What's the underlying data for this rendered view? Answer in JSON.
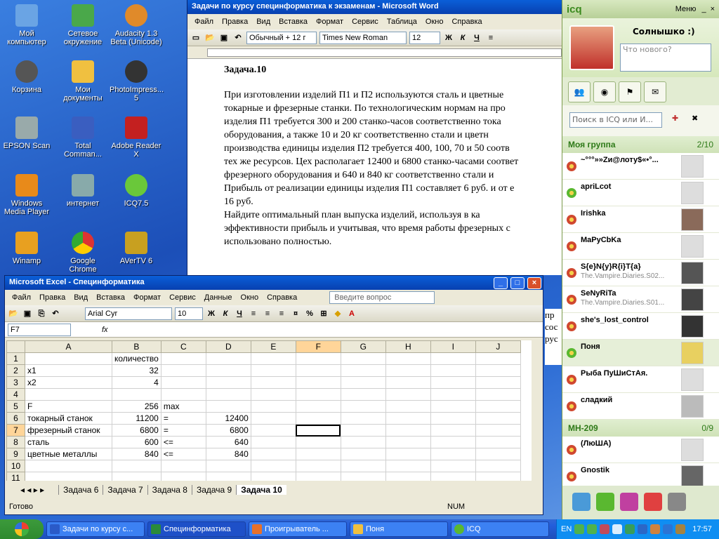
{
  "desktop_icons": [
    {
      "label": "Мой компьютер"
    },
    {
      "label": "Сетевое окружение"
    },
    {
      "label": "Audacity 1.3 Beta (Unicode)"
    },
    {
      "label": "Корзина"
    },
    {
      "label": "Мои документы"
    },
    {
      "label": "PhotoImpress... 5"
    },
    {
      "label": "EPSON Scan"
    },
    {
      "label": "Total Comman..."
    },
    {
      "label": "Adobe Reader X"
    },
    {
      "label": "Windows Media Player"
    },
    {
      "label": "интернет"
    },
    {
      "label": "ICQ7.5"
    },
    {
      "label": "Winamp"
    },
    {
      "label": "Google Chrome"
    },
    {
      "label": "AVerTV 6"
    }
  ],
  "word": {
    "title": "Задачи по курсу специнформатика к экзаменам - Microsoft Word",
    "menu": [
      "Файл",
      "Правка",
      "Вид",
      "Вставка",
      "Формат",
      "Сервис",
      "Таблица",
      "Окно",
      "Справка"
    ],
    "style_box": "Обычный + 12 г",
    "font_box": "Times New Roman",
    "size_box": "12",
    "bold": "Ж",
    "italic": "К",
    "underline": "Ч",
    "heading": "Задача.10",
    "lines": [
      "При изготовлении изделий П1 и П2  используются сталь и цветные",
      "токарные и фрезерные станки. По технологическим нормам на про",
      "изделия П1 требуется 300 и 200 станко-часов соответственно тока",
      "оборудования, а также 10 и 20 кг соответственно стали и цветн",
      "производства единицы изделия П2  требуется 400, 100, 70 и 50 соотв",
      "тех же ресурсов. Цех располагает 12400 и 6800 станко-часами соответ",
      "фрезерного оборудования и 640 и 840 кг соответственно стали и",
      "Прибыль от реализации единицы изделия П1 составляет 6 руб. и от е",
      "16 руб.",
      "Найдите оптимальный план выпуска изделий, используя в ка",
      "эффективности прибыль и учитывая, что время работы фрезерных с",
      "использовано полностью."
    ],
    "peek_lines": [
      "пр",
      "сос",
      "",
      "рус"
    ]
  },
  "excel": {
    "title": "Microsoft Excel - Специнформатика",
    "menu": [
      "Файл",
      "Правка",
      "Вид",
      "Вставка",
      "Формат",
      "Сервис",
      "Данные",
      "Окно",
      "Справка"
    ],
    "help_placeholder": "Введите вопрос",
    "font_box": "Arial Cyr",
    "size_box": "10",
    "name_box": "F7",
    "fx": "fx",
    "col_headers": [
      "A",
      "B",
      "C",
      "D",
      "E",
      "F",
      "G",
      "H",
      "I",
      "J"
    ],
    "rows": [
      {
        "n": "1",
        "a": "",
        "b": "количество",
        "c": "",
        "d": ""
      },
      {
        "n": "2",
        "a": "x1",
        "b": "32",
        "c": "",
        "d": ""
      },
      {
        "n": "3",
        "a": "x2",
        "b": "4",
        "c": "",
        "d": ""
      },
      {
        "n": "4",
        "a": "",
        "b": "",
        "c": "",
        "d": ""
      },
      {
        "n": "5",
        "a": "F",
        "b": "256",
        "c": "max",
        "d": ""
      },
      {
        "n": "6",
        "a": "токарный станок",
        "b": "11200",
        "c": "=",
        "d": "12400"
      },
      {
        "n": "7",
        "a": "фрезерный станок",
        "b": "6800",
        "c": "=",
        "d": "6800"
      },
      {
        "n": "8",
        "a": "сталь",
        "b": "600",
        "c": "<=",
        "d": "640"
      },
      {
        "n": "9",
        "a": "цветные металлы",
        "b": "840",
        "c": "<=",
        "d": "840"
      },
      {
        "n": "10",
        "a": "",
        "b": "",
        "c": "",
        "d": ""
      },
      {
        "n": "11",
        "a": "",
        "b": "",
        "c": "",
        "d": ""
      },
      {
        "n": "12",
        "a": "",
        "b": "",
        "c": "",
        "d": ""
      }
    ],
    "sheet_tabs": [
      "Задача 6",
      "Задача 7",
      "Задача 8",
      "Задача 9",
      "Задача 10"
    ],
    "status_left": "Готово",
    "status_right": "NUM"
  },
  "icq": {
    "title": "icq",
    "menu": "Меню",
    "nick": "Солнышко :)",
    "status_placeholder": "Что нового?",
    "search_placeholder": "Поиск в ICQ или И...",
    "groups": [
      {
        "name": "Моя группа",
        "count": "2/10",
        "contacts": [
          {
            "name": "~°°°»»Zи@лоту$«•°...",
            "status": ""
          },
          {
            "name": "apriLcot",
            "status": ""
          },
          {
            "name": "Irishka",
            "status": ""
          },
          {
            "name": "MaPyCbKa",
            "status": ""
          },
          {
            "name": "S{e}N{y}R{i}T{a}",
            "status": "The.Vampire.Diaries.S02..."
          },
          {
            "name": "SeNyRiTa",
            "status": "The.Vampire.Diaries.S01..."
          },
          {
            "name": "she's_lost_control",
            "status": ""
          },
          {
            "name": "Поня",
            "status": ""
          },
          {
            "name": "Рыба ПуШиСтАя.",
            "status": ""
          },
          {
            "name": "сладкий",
            "status": ""
          }
        ]
      },
      {
        "name": "МН-209",
        "count": "0/9",
        "contacts": [
          {
            "name": "(ЛюША)",
            "status": ""
          },
          {
            "name": "Gnostik",
            "status": ""
          }
        ]
      }
    ]
  },
  "taskbar": {
    "tasks": [
      "Задачи по курсу с...",
      "Специнформатика",
      "Проигрыватель ...",
      "Поня",
      "ICQ"
    ],
    "lang": "EN",
    "clock": "17:57"
  },
  "colors": {
    "xp_blue": "#245edb",
    "icq_green": "#2e7a18",
    "excel_header": "#ece9d8"
  }
}
